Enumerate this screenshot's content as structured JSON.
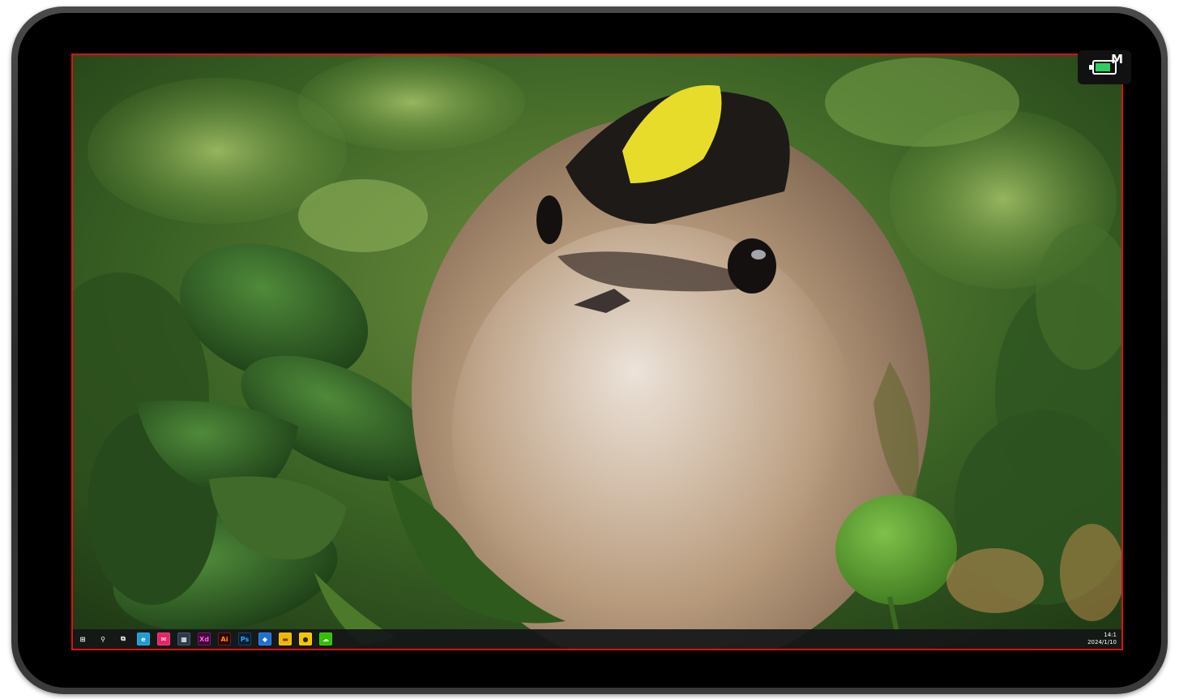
{
  "device": {
    "frame_color": "#333333",
    "bezel_color": "#000000",
    "highlight_border_color": "#e01010"
  },
  "desktop": {
    "wallpaper_subject": "bird-photo"
  },
  "status_badge": {
    "icon": "battery-icon",
    "letter": "M",
    "battery_fill_color": "#2ad160"
  },
  "taskbar": {
    "icons": [
      {
        "name": "start-icon",
        "label": "",
        "bg": "transparent",
        "fg": "#ffffff",
        "glyph": "⊞"
      },
      {
        "name": "search-icon",
        "label": "",
        "bg": "transparent",
        "fg": "#ffffff",
        "glyph": "⚲"
      },
      {
        "name": "task-view-icon",
        "label": "",
        "bg": "transparent",
        "fg": "#ffffff",
        "glyph": "⧉"
      },
      {
        "name": "edge-icon",
        "label": "",
        "bg": "#1f9bd6",
        "fg": "#ffffff",
        "glyph": "e"
      },
      {
        "name": "mail-app-icon",
        "label": "",
        "bg": "#e6246a",
        "fg": "#ffffff",
        "glyph": "✉"
      },
      {
        "name": "calculator-icon",
        "label": "",
        "bg": "#2b3a4a",
        "fg": "#ffffff",
        "glyph": "▦"
      },
      {
        "name": "adobe-xd-icon",
        "label": "Xd",
        "bg": "#470137",
        "fg": "#ff61f6",
        "glyph": ""
      },
      {
        "name": "adobe-illustrator-icon",
        "label": "Ai",
        "bg": "#330000",
        "fg": "#ff9a00",
        "glyph": ""
      },
      {
        "name": "adobe-photoshop-icon",
        "label": "Ps",
        "bg": "#001e36",
        "fg": "#31a8ff",
        "glyph": ""
      },
      {
        "name": "app-blue-icon",
        "label": "",
        "bg": "#1e6fd9",
        "fg": "#ffffff",
        "glyph": "◆"
      },
      {
        "name": "file-explorer-icon",
        "label": "",
        "bg": "#f2b705",
        "fg": "#6b4a00",
        "glyph": "▬"
      },
      {
        "name": "app-yellow-icon",
        "label": "",
        "bg": "#f5c400",
        "fg": "#2a2a2a",
        "glyph": "●"
      },
      {
        "name": "wechat-icon",
        "label": "",
        "bg": "#2dc100",
        "fg": "#ffffff",
        "glyph": "☁"
      }
    ],
    "clock": {
      "time": "14:1",
      "date": "2024/1/10"
    }
  }
}
